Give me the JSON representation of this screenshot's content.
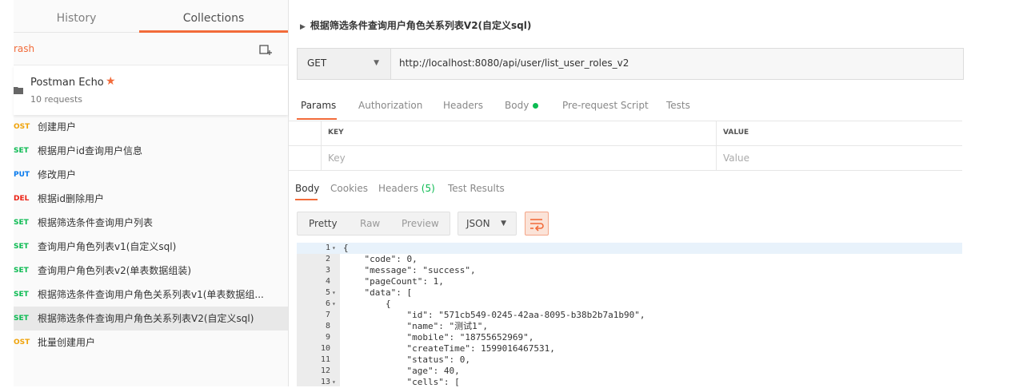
{
  "sidebar": {
    "tabs": [
      "History",
      "Collections"
    ],
    "trash_label": "rash",
    "new_collection_icon": "new-collection-icon",
    "collection": {
      "name": "Postman Echo",
      "count": "10 requests",
      "star_color": "#f26b3a"
    },
    "requests": [
      {
        "method": "OST",
        "name": "创建用户",
        "kind": "post"
      },
      {
        "method": "SET",
        "name": "根据用户id查询用户信息",
        "kind": "get"
      },
      {
        "method": "PUT",
        "name": "修改用户",
        "kind": "put"
      },
      {
        "method": "DEL",
        "name": "根据id删除用户",
        "kind": "del"
      },
      {
        "method": "SET",
        "name": "根据筛选条件查询用户列表",
        "kind": "get"
      },
      {
        "method": "SET",
        "name": "查询用户角色列表v1(自定义sql)",
        "kind": "get"
      },
      {
        "method": "SET",
        "name": "查询用户角色列表v2(单表数据组装)",
        "kind": "get"
      },
      {
        "method": "SET",
        "name": "根据筛选条件查询用户角色关系列表v1(单表数据组...",
        "kind": "get"
      },
      {
        "method": "SET",
        "name": "根据筛选条件查询用户角色关系列表V2(自定义sql)",
        "kind": "get"
      },
      {
        "method": "OST",
        "name": "批量创建用户",
        "kind": "post"
      }
    ]
  },
  "main": {
    "title": "根据筛选条件查询用户角色关系列表V2(自定义sql)",
    "method": "GET",
    "url": "http://localhost:8080/api/user/list_user_roles_v2",
    "request_tabs": [
      "Params",
      "Authorization",
      "Headers",
      "Body",
      "Pre-request Script",
      "Tests"
    ],
    "params": {
      "key_header": "KEY",
      "value_header": "VALUE",
      "key_placeholder": "Key",
      "value_placeholder": "Value"
    },
    "response_tabs": {
      "body": "Body",
      "cookies": "Cookies",
      "headers": "Headers",
      "headers_count": "(5)",
      "tests": "Test Results"
    },
    "formats": [
      "Pretty",
      "Raw",
      "Preview"
    ],
    "json_label": "JSON",
    "code_lines": [
      {
        "n": "1",
        "fold": "▾",
        "text": "{"
      },
      {
        "n": "2",
        "fold": "",
        "text": "    \"code\": 0,"
      },
      {
        "n": "3",
        "fold": "",
        "text": "    \"message\": \"success\","
      },
      {
        "n": "4",
        "fold": "",
        "text": "    \"pageCount\": 1,"
      },
      {
        "n": "5",
        "fold": "▾",
        "text": "    \"data\": ["
      },
      {
        "n": "6",
        "fold": "▾",
        "text": "        {"
      },
      {
        "n": "7",
        "fold": "",
        "text": "            \"id\": \"571cb549-0245-42aa-8095-b38b2b7a1b90\","
      },
      {
        "n": "8",
        "fold": "",
        "text": "            \"name\": \"测试1\","
      },
      {
        "n": "9",
        "fold": "",
        "text": "            \"mobile\": \"18755652969\","
      },
      {
        "n": "10",
        "fold": "",
        "text": "            \"createTime\": 1599016467531,"
      },
      {
        "n": "11",
        "fold": "",
        "text": "            \"status\": 0,"
      },
      {
        "n": "12",
        "fold": "",
        "text": "            \"age\": 40,"
      },
      {
        "n": "13",
        "fold": "▾",
        "text": "            \"cells\": ["
      }
    ]
  }
}
